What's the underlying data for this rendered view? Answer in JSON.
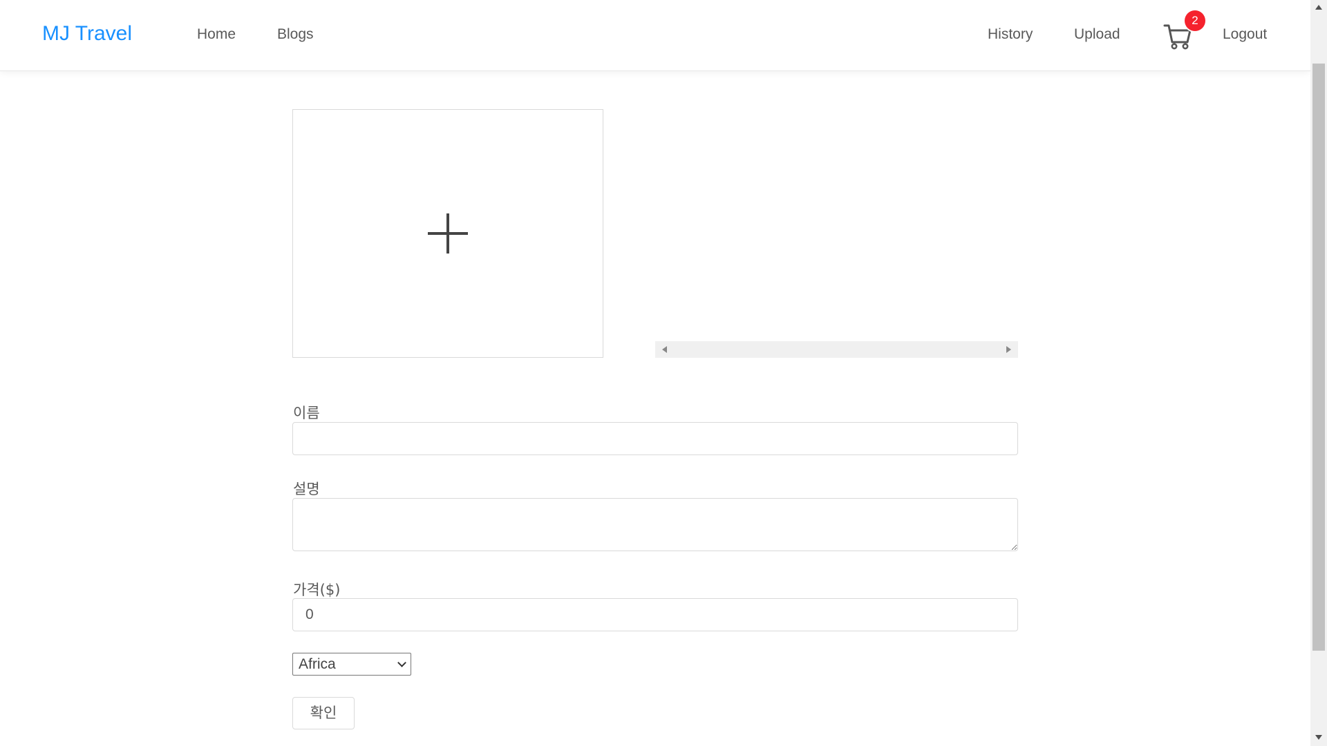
{
  "header": {
    "logo": "MJ Travel",
    "left_nav": [
      {
        "label": "Home"
      },
      {
        "label": "Blogs"
      }
    ],
    "right_nav": [
      {
        "label": "History"
      },
      {
        "label": "Upload"
      },
      {
        "label": "Logout"
      }
    ],
    "cart": {
      "icon": "shopping-cart-icon",
      "count": "2",
      "badge_color": "#f5222d"
    }
  },
  "upload": {
    "dropzone_icon": "plus-icon"
  },
  "form": {
    "name_label": "이름",
    "name_value": "",
    "description_label": "설명",
    "description_value": "",
    "price_label": "가격($)",
    "price_value": "0",
    "continent_selected": "Africa",
    "submit_label": "확인"
  },
  "colors": {
    "brand": "#1890ff",
    "text": "#595959",
    "border": "#d9d9d9"
  }
}
